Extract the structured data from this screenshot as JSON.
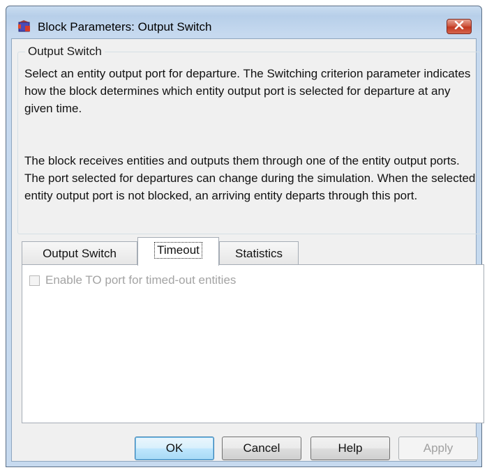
{
  "window": {
    "title": "Block Parameters: Output Switch"
  },
  "group": {
    "legend": "Output Switch",
    "description_1": "Select an entity output port for departure. The Switching criterion parameter indicates how the block determines which entity output port is selected for departure at any given time.",
    "description_2": "The block receives entities and outputs them through one of the entity output ports. The port selected for departures can change during the simulation. When the selected entity output port is not blocked, an arriving entity departs through this port."
  },
  "tabs": [
    {
      "label": "Output Switch",
      "active": false
    },
    {
      "label": "Timeout",
      "active": true
    },
    {
      "label": "Statistics",
      "active": false
    }
  ],
  "timeout_tab": {
    "enable_to_port": {
      "label": "Enable TO port for timed-out entities",
      "checked": false,
      "enabled": false
    }
  },
  "buttons": {
    "ok": "OK",
    "cancel": "Cancel",
    "help": "Help",
    "apply": "Apply"
  },
  "icons": {
    "app": "simulink-block-icon",
    "close": "close-icon"
  },
  "colors": {
    "title_bar": "#c6d9ef",
    "close_button": "#c7452d",
    "dialog_background": "#f0f0f0",
    "default_button_border": "#3c7fb1"
  }
}
